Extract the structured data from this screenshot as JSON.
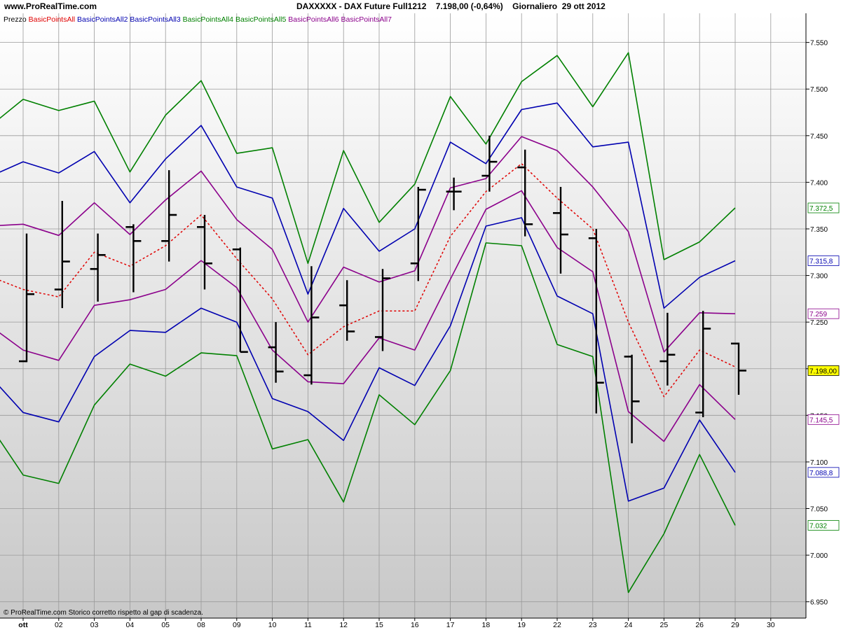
{
  "header": {
    "site": "www.ProRealTime.com",
    "title": "DAXXXXX - DAX Future Full1212    7.198,00 (-0,64%)    Giornaliero  29 ott 2012"
  },
  "legend": [
    {
      "text": "Prezzo",
      "color": "#000000"
    },
    {
      "text": "BasicPointsAll",
      "color": "#e00000"
    },
    {
      "text": "BasicPointsAll2",
      "color": "#0000b0"
    },
    {
      "text": "BasicPointsAll3",
      "color": "#0000b0"
    },
    {
      "text": "BasicPointsAll4",
      "color": "#008000"
    },
    {
      "text": "BasicPointsAll5",
      "color": "#008000"
    },
    {
      "text": "BasicPointsAll6",
      "color": "#8b008b"
    },
    {
      "text": "BasicPointsAll7",
      "color": "#8b008b"
    }
  ],
  "footer_text": "© ProRealTime.com  Storico corretto rispetto al gap di scadenza.",
  "chart_data": {
    "type": "line",
    "x": [
      "",
      "ott",
      "02",
      "03",
      "04",
      "05",
      "08",
      "09",
      "10",
      "11",
      "12",
      "15",
      "16",
      "17",
      "18",
      "19",
      "22",
      "23",
      "24",
      "25",
      "26",
      "29"
    ],
    "x_ticks": [
      "ott",
      "02",
      "03",
      "04",
      "05",
      "08",
      "09",
      "10",
      "11",
      "12",
      "15",
      "16",
      "17",
      "18",
      "19",
      "22",
      "23",
      "24",
      "25",
      "26",
      "29",
      "30"
    ],
    "ylim": [
      6940,
      7570
    ],
    "y_ticks": [
      6950,
      7000,
      7050,
      7100,
      7150,
      7200,
      7250,
      7300,
      7350,
      7400,
      7450,
      7500,
      7550
    ],
    "y_tick_labels": [
      "6.950",
      "7.000",
      "7.050",
      "7.100",
      "7.150",
      "7.200",
      "7.250",
      "7.300",
      "7.350",
      "7.400",
      "7.450",
      "7.500",
      "7.550"
    ],
    "grid": true,
    "ohlc": [
      {
        "x": "ott",
        "open": 7208,
        "high": 7345,
        "low": 7207,
        "close": 7280
      },
      {
        "x": "02",
        "open": 7285,
        "high": 7380,
        "low": 7265,
        "close": 7315
      },
      {
        "x": "03",
        "open": 7307,
        "high": 7345,
        "low": 7272,
        "close": 7322
      },
      {
        "x": "04",
        "open": 7352,
        "high": 7355,
        "low": 7282,
        "close": 7337
      },
      {
        "x": "05",
        "open": 7337,
        "high": 7413,
        "low": 7315,
        "close": 7365
      },
      {
        "x": "08",
        "open": 7352,
        "high": 7365,
        "low": 7285,
        "close": 7313
      },
      {
        "x": "09",
        "open": 7328,
        "high": 7330,
        "low": 7218,
        "close": 7218
      },
      {
        "x": "10",
        "open": 7223,
        "high": 7250,
        "low": 7185,
        "close": 7197
      },
      {
        "x": "11",
        "open": 7193,
        "high": 7310,
        "low": 7183,
        "close": 7255
      },
      {
        "x": "12",
        "open": 7268,
        "high": 7295,
        "low": 7230,
        "close": 7240
      },
      {
        "x": "15",
        "open": 7234,
        "high": 7307,
        "low": 7219,
        "close": 7297
      },
      {
        "x": "16",
        "open": 7313,
        "high": 7395,
        "low": 7294,
        "close": 7392
      },
      {
        "x": "17",
        "open": 7390,
        "high": 7405,
        "low": 7370,
        "close": 7390
      },
      {
        "x": "18",
        "open": 7407,
        "high": 7450,
        "low": 7390,
        "close": 7422
      },
      {
        "x": "19",
        "open": 7416,
        "high": 7435,
        "low": 7342,
        "close": 7355
      },
      {
        "x": "22",
        "open": 7367,
        "high": 7395,
        "low": 7302,
        "close": 7344
      },
      {
        "x": "23",
        "open": 7340,
        "high": 7350,
        "low": 7152,
        "close": 7185
      },
      {
        "x": "24",
        "open": 7213,
        "high": 7215,
        "low": 7120,
        "close": 7165
      },
      {
        "x": "25",
        "open": 7208,
        "high": 7260,
        "low": 7182,
        "close": 7215
      },
      {
        "x": "26",
        "open": 7153,
        "high": 7262,
        "low": 7148,
        "close": 7243
      },
      {
        "x": "29",
        "open": 7227,
        "high": 7228,
        "low": 7172,
        "close": 7198
      }
    ],
    "series": [
      {
        "name": "BasicPointsAll",
        "color": "#e00000",
        "dashed": true,
        "values": [
          7300,
          7285,
          7277,
          7325,
          7310,
          7332,
          7365,
          7318,
          7275,
          7215,
          7245,
          7262,
          7262,
          7342,
          7390,
          7420,
          7383,
          7350,
          7250,
          7170,
          7220,
          7202
        ]
      },
      {
        "name": "BasicPointsAll2",
        "color": "#0000b0",
        "values": [
          7405,
          7422,
          7410,
          7433,
          7378,
          7425,
          7461,
          7395,
          7383,
          7280,
          7372,
          7326,
          7350,
          7443,
          7420,
          7478,
          7485,
          7438,
          7443,
          7265,
          7298,
          7315.8
        ]
      },
      {
        "name": "BasicPointsAll3",
        "color": "#0000b0",
        "values": [
          7195,
          7153,
          7143,
          7213,
          7241,
          7239,
          7265,
          7250,
          7168,
          7154,
          7123,
          7201,
          7182,
          7246,
          7353,
          7362,
          7278,
          7259,
          7058,
          7072,
          7145,
          7088.8
        ]
      },
      {
        "name": "BasicPointsAll4",
        "color": "#008000",
        "values": [
          7458,
          7489,
          7477,
          7487,
          7411,
          7472,
          7509,
          7431,
          7437,
          7313,
          7434,
          7357,
          7398,
          7492,
          7441,
          7508,
          7536,
          7481,
          7539,
          7317,
          7336,
          7372.5
        ]
      },
      {
        "name": "BasicPointsAll5",
        "color": "#008000",
        "values": [
          7143,
          7086,
          7077,
          7161,
          7205,
          7192,
          7217,
          7214,
          7114,
          7124,
          7057,
          7172,
          7140,
          7198,
          7335,
          7332,
          7226,
          7213,
          6960,
          7023,
          7108,
          7032
        ]
      },
      {
        "name": "BasicPointsAll6",
        "color": "#8b008b",
        "values": [
          7353,
          7355,
          7343,
          7378,
          7344,
          7381,
          7412,
          7360,
          7328,
          7250,
          7309,
          7293,
          7305,
          7394,
          7404,
          7449,
          7434,
          7395,
          7347,
          7218,
          7260,
          7259
        ]
      },
      {
        "name": "BasicPointsAll7",
        "color": "#8b008b",
        "values": [
          7248,
          7220,
          7209,
          7268,
          7274,
          7285,
          7316,
          7287,
          7220,
          7186,
          7184,
          7233,
          7220,
          7296,
          7371,
          7391,
          7330,
          7304,
          7154,
          7122,
          7183,
          7145.5
        ]
      }
    ],
    "value_tags": [
      {
        "value": 7372.5,
        "label": "7.372,5",
        "color": "#008000"
      },
      {
        "value": 7315.8,
        "label": "7.315,8",
        "color": "#0000b0"
      },
      {
        "value": 7259,
        "label": "7.259",
        "color": "#8b008b"
      },
      {
        "value": 7198,
        "label": "7.198,00",
        "color": "#000000",
        "highlight": true
      },
      {
        "value": 7145.5,
        "label": "7.145,5",
        "color": "#8b008b"
      },
      {
        "value": 7088.8,
        "label": "7.088,8",
        "color": "#0000b0"
      },
      {
        "value": 7032,
        "label": "7.032",
        "color": "#008000"
      }
    ]
  }
}
